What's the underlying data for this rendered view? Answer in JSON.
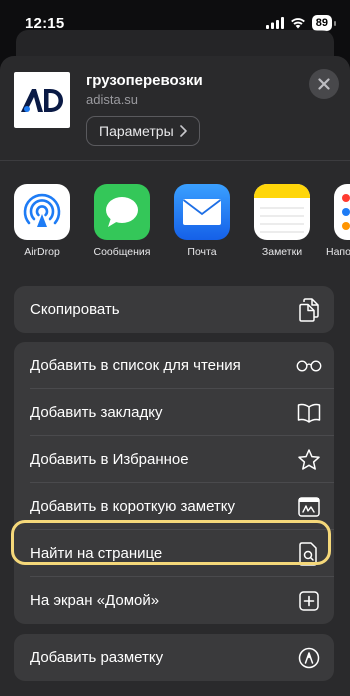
{
  "status_bar": {
    "time": "12:15",
    "battery": "89"
  },
  "header": {
    "site_title": "грузоперевозки",
    "site_url": "adista.su",
    "options_label": "Параметры"
  },
  "apps": [
    {
      "label": "AirDrop",
      "icon": "airdrop-icon"
    },
    {
      "label": "Сообщения",
      "icon": "messages-icon"
    },
    {
      "label": "Почта",
      "icon": "mail-icon"
    },
    {
      "label": "Заметки",
      "icon": "notes-icon"
    },
    {
      "label": "Напо",
      "icon": "reminders-icon"
    }
  ],
  "actions_group1": [
    {
      "label": "Скопировать",
      "icon": "copy-icon"
    }
  ],
  "actions_group2": [
    {
      "label": "Добавить в список для чтения",
      "icon": "glasses-icon"
    },
    {
      "label": "Добавить закладку",
      "icon": "book-icon"
    },
    {
      "label": "Добавить в Избранное",
      "icon": "star-icon"
    },
    {
      "label": "Добавить в короткую заметку",
      "icon": "quick-note-icon"
    },
    {
      "label": "Найти на странице",
      "icon": "find-doc-icon"
    },
    {
      "label": "На экран «Домой»",
      "icon": "plus-square-icon"
    }
  ],
  "actions_group3": [
    {
      "label": "Добавить разметку",
      "icon": "markup-icon"
    }
  ],
  "colors": {
    "highlight": "#f5d87a",
    "messages": "#34c759",
    "mail": "#1e7cf5",
    "notes": "#ffd60a"
  }
}
